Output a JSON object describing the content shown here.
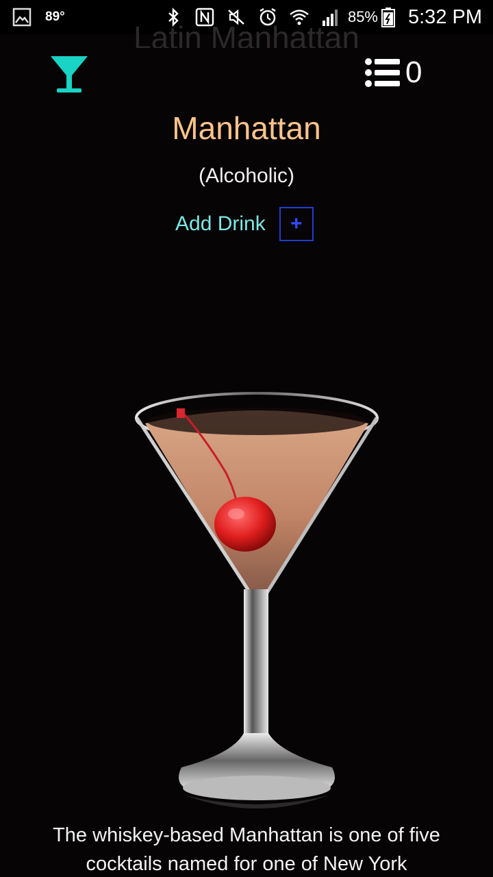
{
  "status_bar": {
    "temperature": "89°",
    "battery_percent": "85%",
    "time": "5:32 PM",
    "icons": [
      "gallery-icon",
      "bluetooth-icon",
      "nfc-icon",
      "mute-icon",
      "alarm-icon",
      "wifi-icon",
      "signal-icon",
      "battery-icon"
    ]
  },
  "header": {
    "ghost_title": "Latin Manhattan",
    "app_icon": "cocktail-glass-icon",
    "list_icon": "list-icon",
    "list_count": "0",
    "accent_color": "#19d3c5"
  },
  "drink": {
    "name": "Manhattan",
    "type": "(Alcoholic)",
    "add_label": "Add Drink",
    "add_button_label": "+",
    "image": "manhattan-cocktail-image",
    "description": "The whiskey-based Manhattan is one of five cocktails named for one of New York"
  },
  "colors": {
    "background": "#070406",
    "name": "#ffc48c",
    "add_label": "#7de9e4",
    "add_button": "#1f3dcc"
  }
}
